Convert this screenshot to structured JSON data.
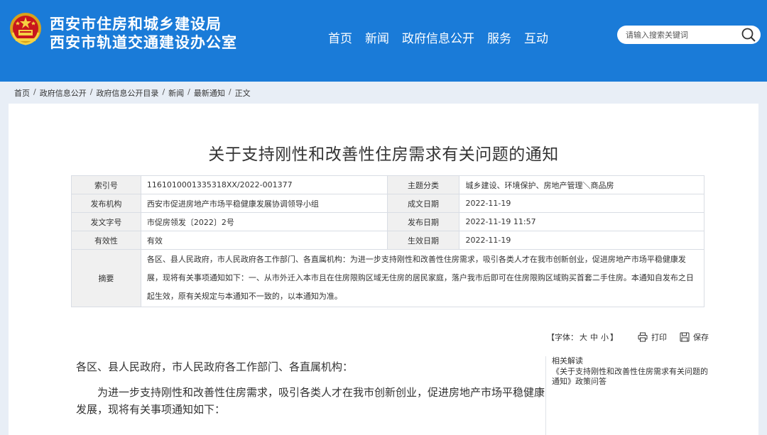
{
  "header": {
    "org_line1": "西安市住房和城乡建设局",
    "org_line2": "西安市轨道交通建设办公室",
    "emblem_icon": "national-emblem-icon",
    "bg_color": "#1a7bd8"
  },
  "nav": {
    "items": [
      {
        "label": "首页"
      },
      {
        "label": "新闻"
      },
      {
        "label": "政府信息公开"
      },
      {
        "label": "服务"
      },
      {
        "label": "互动"
      }
    ]
  },
  "search": {
    "placeholder": "请输入搜索关键词",
    "icon": "search-icon"
  },
  "breadcrumb": {
    "items": [
      "首页",
      "政府信息公开",
      "政府信息公开目录",
      "新闻",
      "最新通知",
      "正文"
    ],
    "separator": "/"
  },
  "article": {
    "title": "关于支持刚性和改善性住房需求有关问题的通知"
  },
  "info": {
    "index_label": "索引号",
    "index_value": "1161010001335318XX/2022-001377",
    "topic_label": "主题分类",
    "topic_value": "城乡建设、环境保护、房地产管理＼商品房",
    "issuer_label": "发布机构",
    "issuer_value": "西安市促进房地产市场平稳健康发展协调领导小组",
    "created_label": "成文日期",
    "created_value": "2022-11-19",
    "docno_label": "发文字号",
    "docno_value": "市促房领发〔2022〕2号",
    "published_label": "发布日期",
    "published_value": "2022-11-19 11:57",
    "validity_label": "有效性",
    "validity_value": "有效",
    "effective_label": "生效日期",
    "effective_value": "2022-11-19",
    "abstract_label": "摘要",
    "abstract_value": "各区、县人民政府，市人民政府各工作部门、各直属机构：为进一步支持刚性和改善性住房需求，吸引各类人才在我市创新创业，促进房地产市场平稳健康发展，现将有关事项通知如下：一、从市外迁入本市且在住房限购区域无住房的居民家庭，落户我市后即可在住房限购区域购买首套二手住房。本通知自发布之日起生效，原有关规定与本通知不一致的，以本通知为准。"
  },
  "tools": {
    "fontsize_prefix": "【字体：",
    "fontsize_big": "大",
    "fontsize_mid": "中",
    "fontsize_small": "小",
    "fontsize_suffix": "】",
    "print_label": "打印",
    "save_label": "保存"
  },
  "body": {
    "salutation": "各区、县人民政府，市人民政府各工作部门、各直属机构：",
    "paragraph1": "为进一步支持刚性和改善性住房需求，吸引各类人才在我市创新创业，促进房地产市场平稳健康发展，现将有关事项通知如下："
  },
  "related": {
    "title": "相关解读",
    "link": "《关于支持刚性和改善性住房需求有关问题的通知》政策问答"
  }
}
